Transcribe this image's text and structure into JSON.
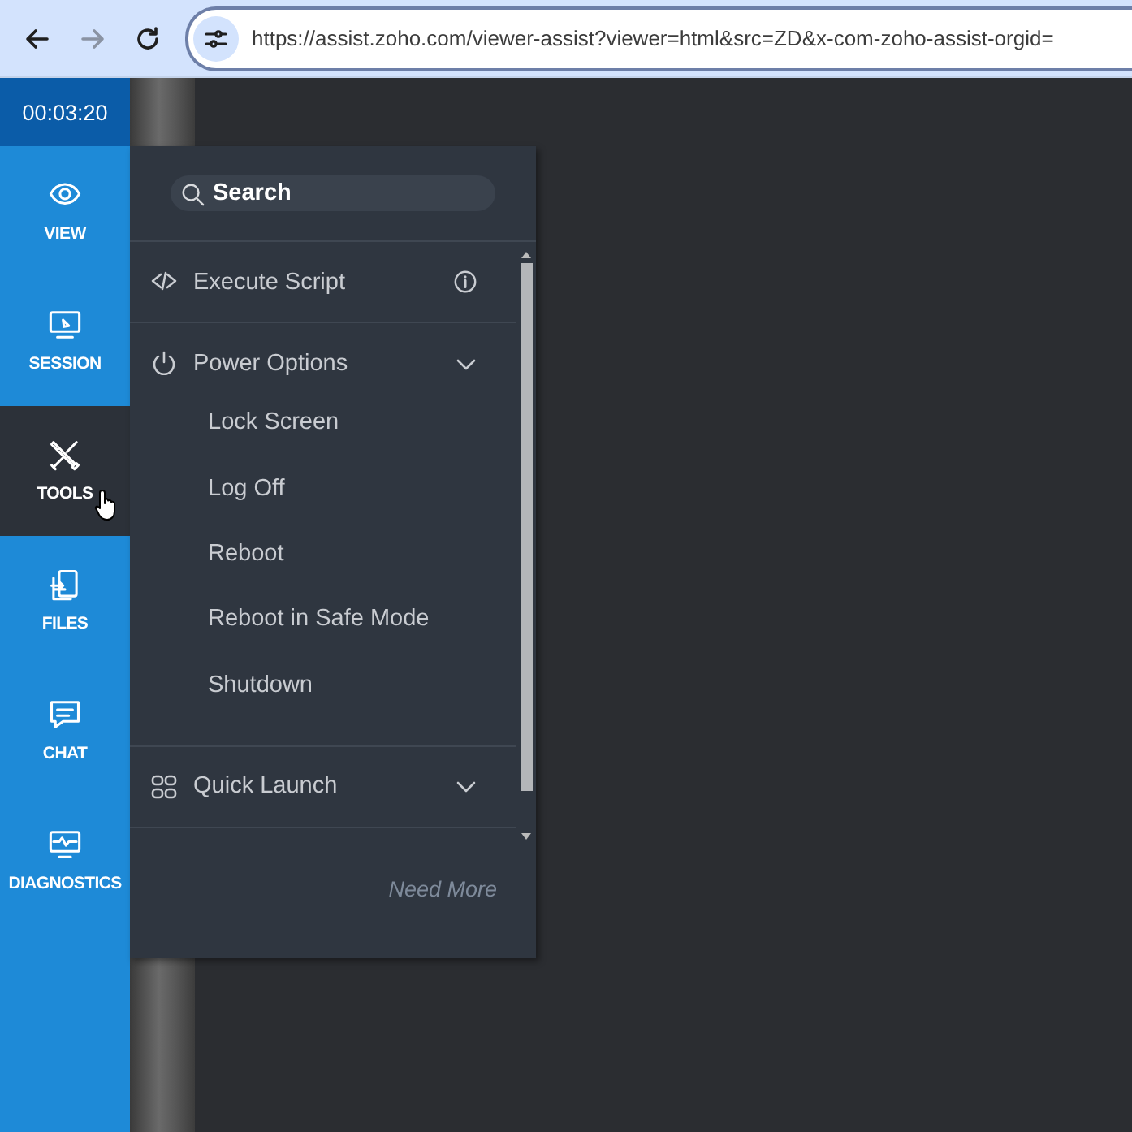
{
  "browser": {
    "url": "https://assist.zoho.com/viewer-assist?viewer=html&src=ZD&x-com-zoho-assist-orgid="
  },
  "timer": "00:03:20",
  "nav": [
    {
      "label": "VIEW",
      "selected": false
    },
    {
      "label": "SESSION",
      "selected": false
    },
    {
      "label": "TOOLS",
      "selected": true
    },
    {
      "label": "FILES",
      "selected": false
    },
    {
      "label": "CHAT",
      "selected": false
    },
    {
      "label": "DIAGNOSTICS",
      "selected": false
    }
  ],
  "menu": {
    "search": {
      "placeholder": "Search"
    },
    "items": [
      {
        "kind": "action",
        "label": "Execute Script"
      },
      {
        "kind": "group",
        "label": "Power Options",
        "expanded": true,
        "children": [
          {
            "label": "Lock Screen"
          },
          {
            "label": "Log Off"
          },
          {
            "label": "Reboot"
          },
          {
            "label": "Reboot in Safe Mode"
          },
          {
            "label": "Shutdown"
          }
        ]
      },
      {
        "kind": "group",
        "label": "Quick Launch"
      }
    ],
    "footer_link": "Need More"
  }
}
